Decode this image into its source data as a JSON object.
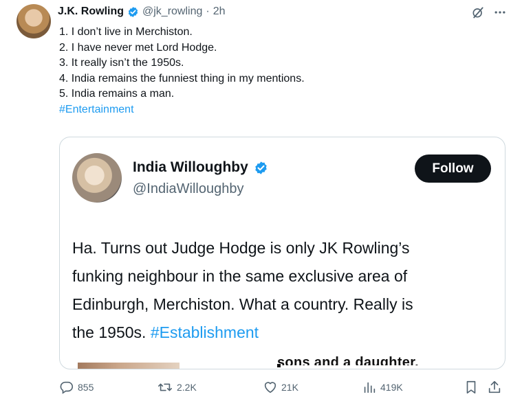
{
  "tweet": {
    "author_name": "J.K. Rowling",
    "handle": "@jk_rowling",
    "separator": "·",
    "time": "2h",
    "lines": [
      "1. I don’t live in Merchiston.",
      "2. I have never met Lord Hodge.",
      "3. It really isn’t the 1950s.",
      "4. India remains the funniest thing in my mentions.",
      "5. India remains a man."
    ],
    "hashtag": "#Entertainment"
  },
  "quote": {
    "name": "India Willoughby",
    "handle": "@IndiaWilloughby",
    "follow_label": "Follow",
    "text_lines": [
      "Ha. Turns out Judge Hodge is only JK Rowling’s",
      "funking neighbour in the same exclusive area of",
      "Edinburgh, Merchiston. What a country. Really is"
    ],
    "last_line_text": "the 1950s. ",
    "hashtag": "#Establishment",
    "cutoff_text": "sons and a daughter."
  },
  "actions": {
    "replies": "855",
    "reposts": "2.2K",
    "likes": "21K",
    "views": "419K"
  },
  "colors": {
    "link": "#1d9bf0",
    "verified": "#1d9bf0",
    "muted": "#536471",
    "follow_bg": "#0f1419"
  }
}
